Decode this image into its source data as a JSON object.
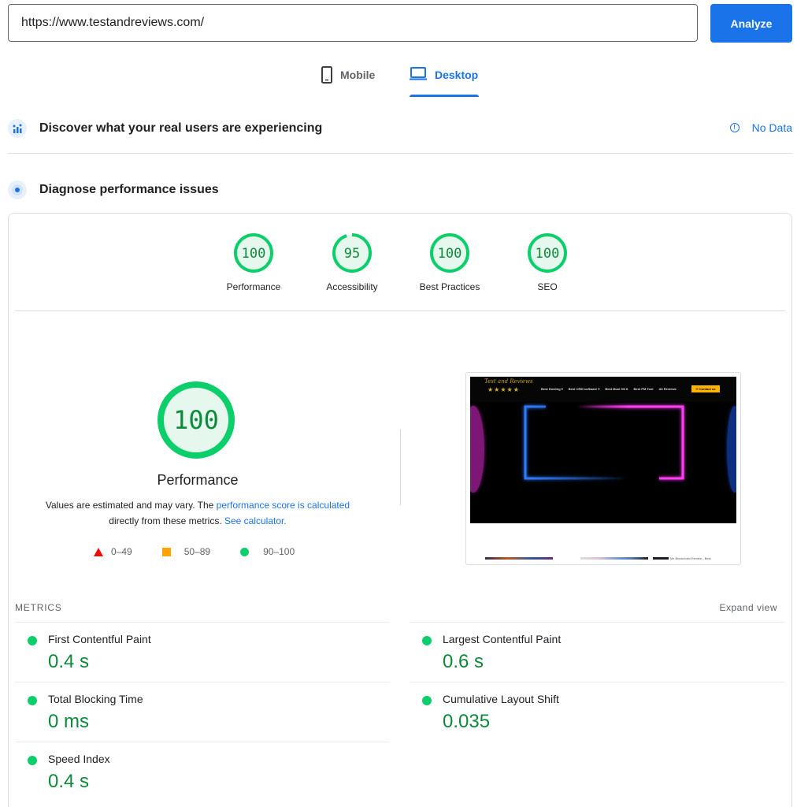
{
  "url_bar": {
    "value": "https://www.testandreviews.com/",
    "analyze_label": "Analyze"
  },
  "tabs": [
    {
      "label": "Mobile",
      "icon": "phone-icon",
      "selected": false
    },
    {
      "label": "Desktop",
      "icon": "laptop-icon",
      "selected": true
    }
  ],
  "discover": {
    "title": "Discover what your real users are experiencing",
    "status_label": "No Data",
    "icon": "crux-users-icon"
  },
  "diagnose": {
    "title": "Diagnose performance issues",
    "icon": "lighthouse-icon"
  },
  "categories": [
    {
      "label": "Performance",
      "score": "100",
      "fraction": 1.0
    },
    {
      "label": "Accessibility",
      "score": "95",
      "fraction": 0.95
    },
    {
      "label": "Best Practices",
      "score": "100",
      "fraction": 1.0
    },
    {
      "label": "SEO",
      "score": "100",
      "fraction": 1.0
    }
  ],
  "performance": {
    "score": "100",
    "title": "Performance",
    "desc_prefix": "Values are estimated and may vary. The ",
    "desc_link": "performance score is calculated",
    "desc_mid": "directly from these metrics. ",
    "desc_link2": "See calculator.",
    "legend": [
      {
        "range": "0–49",
        "shape": "triangle",
        "color": "#eb0f00"
      },
      {
        "range": "50–89",
        "shape": "square",
        "color": "#ffa400"
      },
      {
        "range": "90–100",
        "shape": "circle",
        "color": "#0cce6b"
      }
    ]
  },
  "thumbnail": {
    "logo": "Test and Reviews",
    "stars": "★★★★★",
    "menu": [
      "Best Hosting ▾",
      "Best CRM software ▾",
      "Best Must Hit It",
      "Best PM Tool",
      "All Reviews"
    ],
    "contact": "✉ Contact us",
    "strip_text": "Mz Blockchain Review - Best"
  },
  "metrics": {
    "header": "METRICS",
    "expand_label": "Expand view",
    "items": [
      {
        "label": "First Contentful Paint",
        "value": "0.4 s"
      },
      {
        "label": "Largest Contentful Paint",
        "value": "0.6 s"
      },
      {
        "label": "Total Blocking Time",
        "value": "0 ms"
      },
      {
        "label": "Cumulative Layout Shift",
        "value": "0.035"
      },
      {
        "label": "Speed Index",
        "value": "0.4 s"
      }
    ]
  },
  "colors": {
    "accent": "#1a73e8",
    "pass": "#0cce6b",
    "pass_text": "#0c8a3c",
    "pass_fill": "#e6f8ed"
  }
}
